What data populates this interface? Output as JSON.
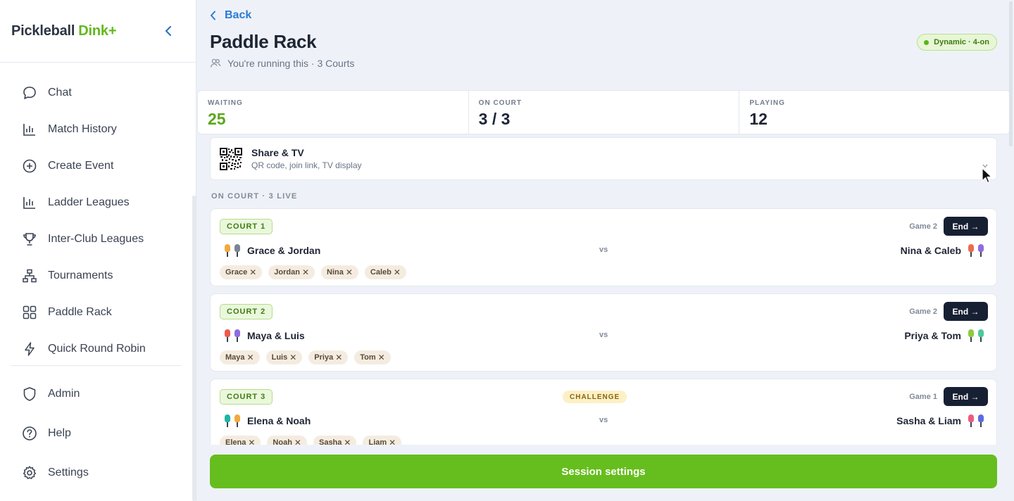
{
  "brand": {
    "name": "Pickleball",
    "accent": "Dink+"
  },
  "sidebar": {
    "items": [
      {
        "label": "Chat",
        "icon": "chat-icon"
      },
      {
        "label": "Match History",
        "icon": "bar-chart-icon"
      },
      {
        "label": "Create Event",
        "icon": "plus-circle-icon"
      },
      {
        "label": "Ladder Leagues",
        "icon": "bar-chart-icon"
      },
      {
        "label": "Inter-Club Leagues",
        "icon": "trophy-icon"
      },
      {
        "label": "Tournaments",
        "icon": "bracket-icon"
      },
      {
        "label": "Paddle Rack",
        "icon": "grid-icon"
      },
      {
        "label": "Quick Round Robin",
        "icon": "lightning-icon"
      }
    ],
    "bottom_items": [
      {
        "label": "Admin",
        "icon": "shield-icon"
      },
      {
        "label": "Help",
        "icon": "help-circle-icon"
      },
      {
        "label": "Settings",
        "icon": "gear-icon"
      }
    ]
  },
  "header": {
    "back_label": "Back",
    "title": "Paddle Rack",
    "subtitle": "You're running this · 3 Courts",
    "mode_badge": "Dynamic · 4-on"
  },
  "stats": [
    {
      "label": "WAITING",
      "value": "25"
    },
    {
      "label": "ON COURT",
      "value": "3 / 3"
    },
    {
      "label": "PLAYING",
      "value": "12"
    }
  ],
  "share": {
    "title": "Share & TV",
    "subtitle": "QR code, join link, TV display"
  },
  "section_label": "ON COURT · 3 LIVE",
  "courts": [
    {
      "badge": "COURT 1",
      "game": "Game 2",
      "end_label": "End →",
      "challenge": "",
      "left_team": "Grace & Jordan",
      "right_team": "Nina & Caleb",
      "vs": "vs",
      "left_colors": [
        "#f2a93b",
        "#7c8594"
      ],
      "right_colors": [
        "#ee6a4c",
        "#8f6be0"
      ],
      "chips": [
        "Grace",
        "Jordan",
        "Nina",
        "Caleb"
      ]
    },
    {
      "badge": "COURT 2",
      "game": "Game 2",
      "end_label": "End →",
      "challenge": "",
      "left_team": "Maya & Luis",
      "right_team": "Priya & Tom",
      "vs": "vs",
      "left_colors": [
        "#ee5a4c",
        "#8f6be0"
      ],
      "right_colors": [
        "#8ccc3a",
        "#4cc99a"
      ],
      "chips": [
        "Maya",
        "Luis",
        "Priya",
        "Tom"
      ]
    },
    {
      "badge": "COURT 3",
      "game": "Game 1",
      "end_label": "End →",
      "challenge": "CHALLENGE",
      "left_team": "Elena & Noah",
      "right_team": "Sasha & Liam",
      "vs": "vs",
      "left_colors": [
        "#1fb5a0",
        "#f2a93b"
      ],
      "right_colors": [
        "#ee5a7c",
        "#5c6be0"
      ],
      "chips": [
        "Elena",
        "Noah",
        "Sasha",
        "Liam"
      ]
    }
  ],
  "session_settings_label": "Session settings",
  "chip_remove_glyph": "✕"
}
